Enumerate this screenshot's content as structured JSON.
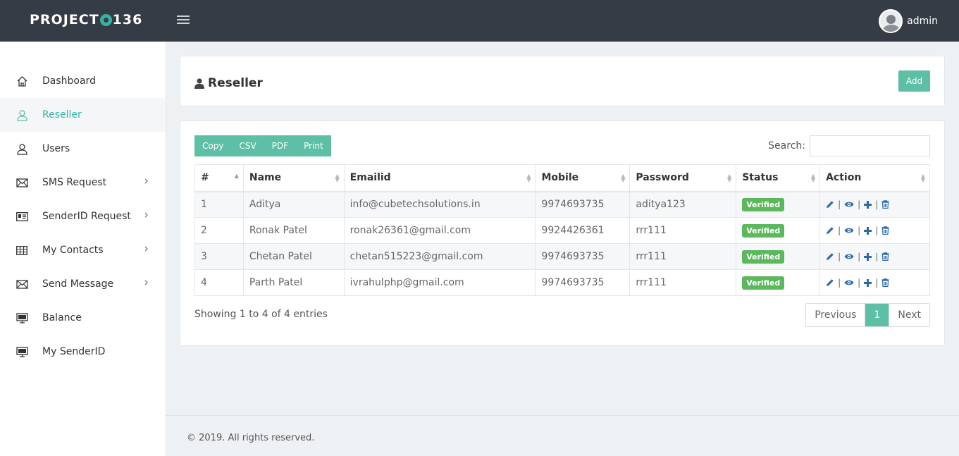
{
  "brand": {
    "left": "PROJECT",
    "right": "136"
  },
  "user": {
    "name": "admin"
  },
  "sidebar": {
    "items": [
      {
        "label": "Dashboard",
        "icon": "home-icon",
        "active": false,
        "chevron": false
      },
      {
        "label": "Reseller",
        "icon": "user-icon",
        "active": true,
        "chevron": false
      },
      {
        "label": "Users",
        "icon": "user-icon",
        "active": false,
        "chevron": false
      },
      {
        "label": "SMS Request",
        "icon": "envelope-icon",
        "active": false,
        "chevron": true
      },
      {
        "label": "SenderID Request",
        "icon": "id-card-icon",
        "active": false,
        "chevron": true
      },
      {
        "label": "My Contacts",
        "icon": "grid-icon",
        "active": false,
        "chevron": true
      },
      {
        "label": "Send Message",
        "icon": "envelope-icon",
        "active": false,
        "chevron": true
      },
      {
        "label": "Balance",
        "icon": "monitor-icon",
        "active": false,
        "chevron": false
      },
      {
        "label": "My SenderID",
        "icon": "monitor-icon",
        "active": false,
        "chevron": false
      }
    ]
  },
  "page": {
    "title": "Reseller",
    "add_label": "Add"
  },
  "toolbar": {
    "copy": "Copy",
    "csv": "CSV",
    "pdf": "PDF",
    "print": "Print",
    "search_label": "Search:"
  },
  "table": {
    "headers": [
      "#",
      "Name",
      "Emailid",
      "Mobile",
      "Password",
      "Status",
      "Action"
    ],
    "rows": [
      {
        "num": "1",
        "name": "Aditya",
        "email": "info@cubetechsolutions.in",
        "mobile": "9974693735",
        "password": "aditya123",
        "status": "Verified"
      },
      {
        "num": "2",
        "name": "Ronak Patel",
        "email": "ronak26361@gmail.com",
        "mobile": "9924426361",
        "password": "rrr111",
        "status": "Verified"
      },
      {
        "num": "3",
        "name": "Chetan Patel",
        "email": "chetan515223@gmail.com",
        "mobile": "9974693735",
        "password": "rrr111",
        "status": "Verified"
      },
      {
        "num": "4",
        "name": "Parth Patel",
        "email": "ivrahulphp@gmail.com",
        "mobile": "9974693735",
        "password": "rrr111",
        "status": "Verified"
      }
    ],
    "info": "Showing 1 to 4 of 4 entries"
  },
  "pager": {
    "previous": "Previous",
    "current": "1",
    "next": "Next"
  },
  "footer": {
    "text": "© 2019. All rights reserved."
  },
  "colors": {
    "accent": "#5cbfa6",
    "topbar": "#353c45",
    "verified": "#5cb85c",
    "action": "#2a6aa8"
  }
}
